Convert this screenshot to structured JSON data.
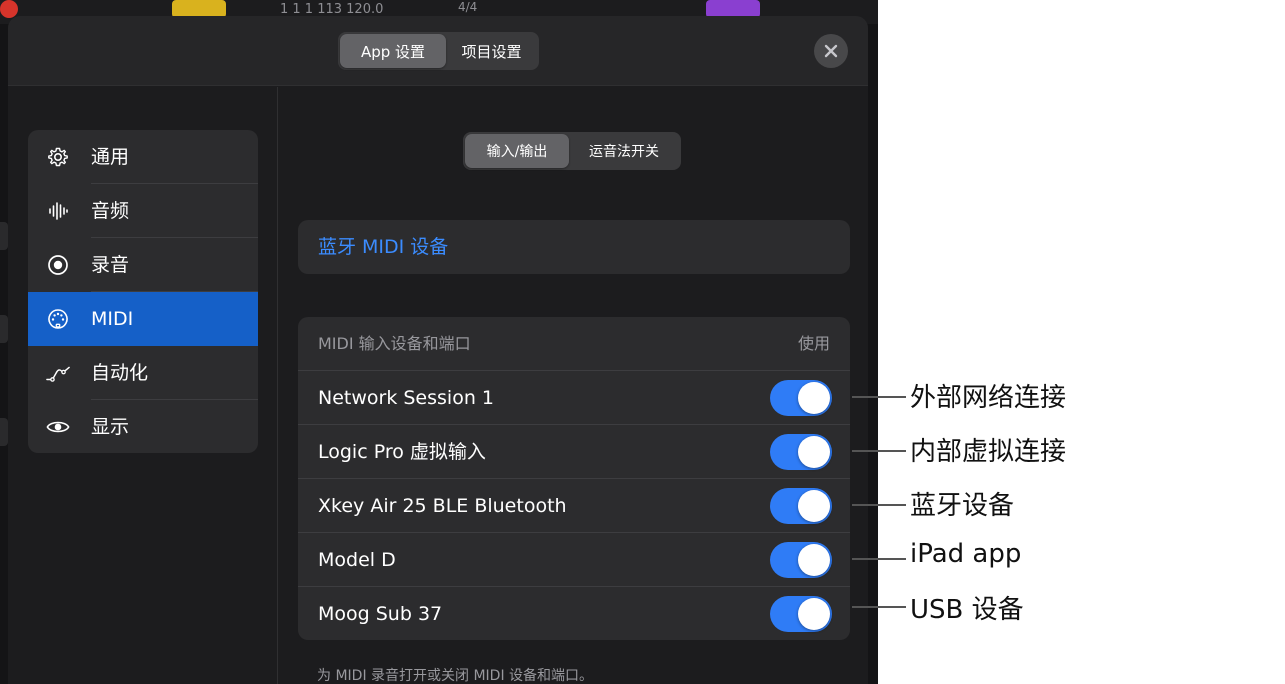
{
  "background_app": {
    "position_readout": "1 1 1 113 120.0",
    "time_signature": "4/4"
  },
  "header": {
    "tabs": [
      {
        "label": "App 设置",
        "active": true
      },
      {
        "label": "项目设置",
        "active": false
      }
    ],
    "close_icon": "close-icon"
  },
  "sidebar": {
    "items": [
      {
        "label": "通用",
        "icon": "gear-icon",
        "active": false
      },
      {
        "label": "音频",
        "icon": "waveform-icon",
        "active": false
      },
      {
        "label": "录音",
        "icon": "record-icon",
        "active": false
      },
      {
        "label": "MIDI",
        "icon": "midi-port-icon",
        "active": true
      },
      {
        "label": "自动化",
        "icon": "automation-curve-icon",
        "active": false
      },
      {
        "label": "显示",
        "icon": "eye-icon",
        "active": false
      }
    ]
  },
  "content": {
    "sub_tabs": [
      {
        "label": "输入/输出",
        "active": true
      },
      {
        "label": "运音法开关",
        "active": false
      }
    ],
    "bluetooth_button": "蓝牙 MIDI 设备",
    "midi_section": {
      "title": "MIDI 输入设备和端口",
      "use_header": "使用",
      "devices": [
        {
          "name": "Network Session 1",
          "enabled": true
        },
        {
          "name": "Logic Pro 虚拟输入",
          "enabled": true
        },
        {
          "name": "Xkey Air 25 BLE Bluetooth",
          "enabled": true
        },
        {
          "name": "Model D",
          "enabled": true
        },
        {
          "name": "Moog Sub 37",
          "enabled": true
        }
      ]
    },
    "footnote": "为 MIDI 录音打开或关闭 MIDI 设备和端口。"
  },
  "callouts": [
    "外部网络连接",
    "内部虚拟连接",
    "蓝牙设备",
    "iPad app",
    "USB 设备"
  ],
  "colors": {
    "accent_blue": "#1560c8",
    "toggle_on": "#2f7cf6",
    "link_blue": "#3b8cff",
    "modal_bg": "#1c1c1e",
    "card_bg": "#2c2c2e"
  }
}
